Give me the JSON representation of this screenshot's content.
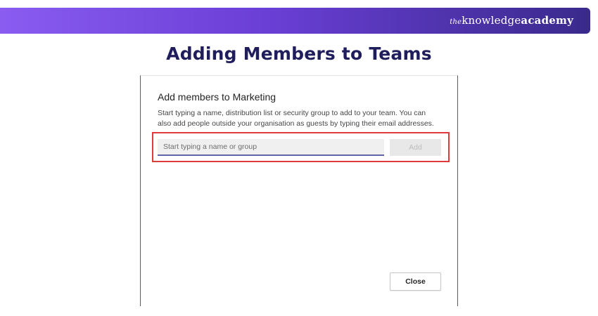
{
  "banner": {
    "brand_prefix": "the",
    "brand_light": "knowledge",
    "brand_bold": "academy",
    "gradient_colors": [
      "#8a5cf0",
      "#6a3fd6",
      "#3a2a8c"
    ]
  },
  "heading": "Adding Members to Teams",
  "dialog": {
    "title": "Add members to Marketing",
    "description": "Start typing a name, distribution list or security group to add to your team. You can also add people outside your organisation as guests by typing their email addresses.",
    "input_placeholder": "Start typing a name or group",
    "add_label": "Add",
    "close_label": "Close",
    "highlight_color": "#e03a3a",
    "accent_color": "#6264a7"
  }
}
